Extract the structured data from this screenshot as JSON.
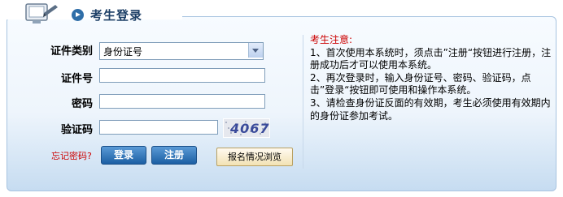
{
  "header": {
    "title": "考生登录"
  },
  "form": {
    "id_type_label": "证件类别",
    "id_type_value": "身份证号",
    "id_number_label": "证件号",
    "password_label": "密码",
    "captcha_label": "验证码",
    "captcha_image_text": "4067",
    "forgot_password": "忘记密码?",
    "login_button": "登录",
    "register_button": "注册",
    "browse_button": "报名情况浏览"
  },
  "notice": {
    "title": "考生注意:",
    "items": [
      "1、首次使用本系统时，须点击”注册“按钮进行注册，注册成功后才可以使用本系统。",
      "2、再次登录时，输入身份证号、密码、验证码，点击”登录“按钮即可使用和操作本系统。",
      "3、请检查身份证反面的有效期，考生必须使用有效期内的身份证参加考试。"
    ]
  },
  "colors": {
    "accent": "#2f6ea8",
    "notice_title": "#cc0000",
    "panel_border": "#a8c4e0"
  }
}
